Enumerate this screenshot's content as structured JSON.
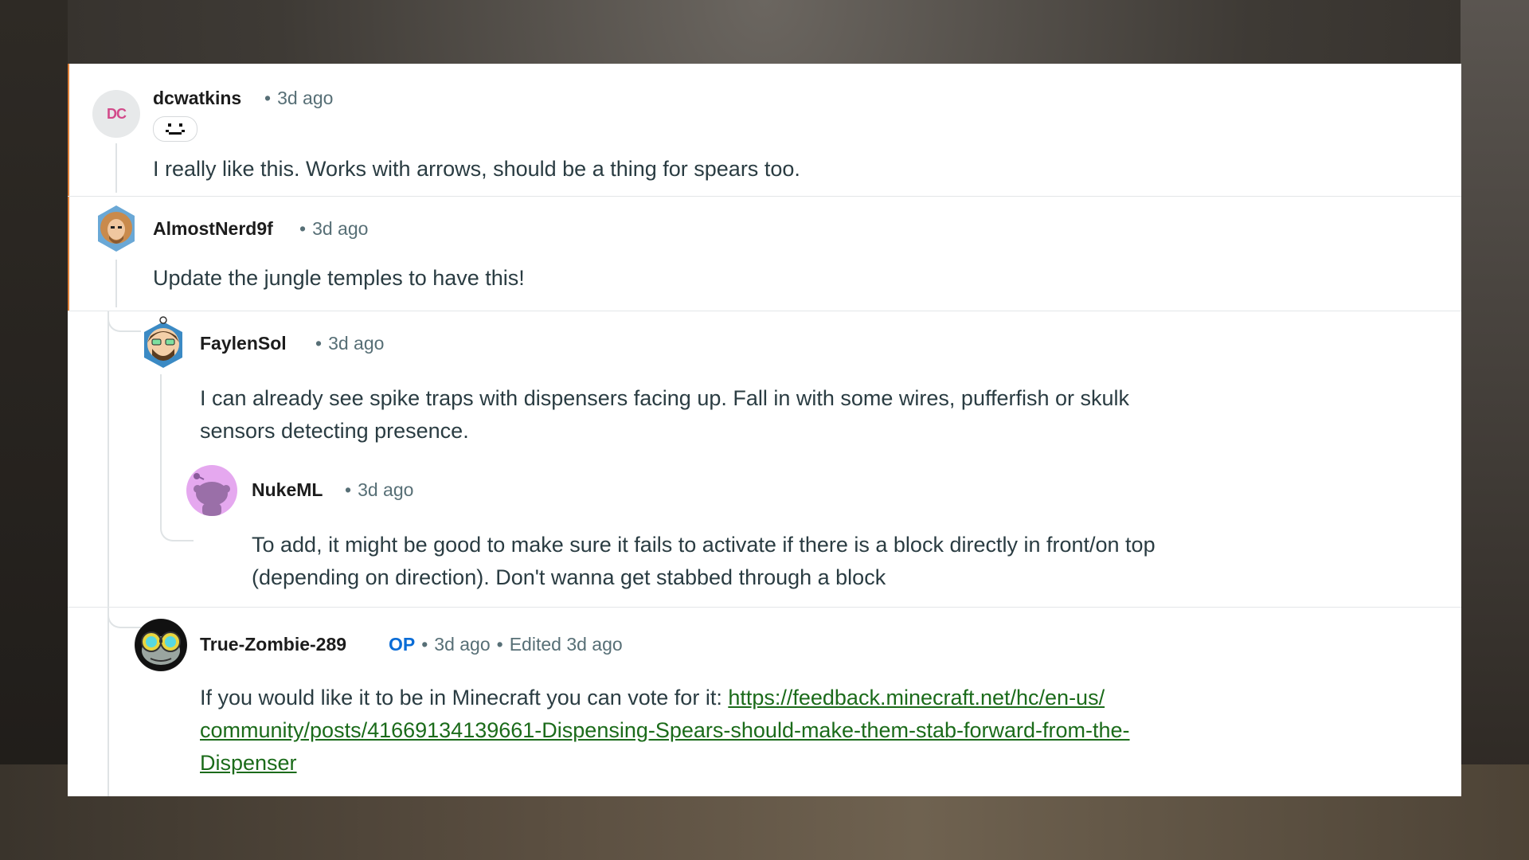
{
  "comments": [
    {
      "username": "dcwatkins",
      "time": "3d ago",
      "avatar_text": "DC",
      "flair_icon": "face-flair-icon",
      "body": "I really like this. Works with arrows, should be a thing for spears too."
    },
    {
      "username": "AlmostNerd9f",
      "time": "3d ago",
      "body": "Update the jungle temples to have this!"
    },
    {
      "username": "FaylenSol",
      "time": "3d ago",
      "body_line1": "I can already see spike traps with dispensers facing up. Fall in with some wires, pufferfish or skulk",
      "body_line2": "sensors detecting presence."
    },
    {
      "username": "NukeML",
      "time": "3d ago",
      "body_line1": "To add, it might be good to make sure it fails to activate if there is a block directly in front/on top",
      "body_line2": "(depending on direction). Don't wanna get stabbed through a block"
    },
    {
      "username": "True-Zombie-289",
      "op_badge": "OP",
      "time": "3d ago",
      "edited": "Edited 3d ago",
      "body_prefix": "If you would like it to be in Minecraft you can vote for it: ",
      "link_line1": "https://feedback.minecraft.net/hc/en-us/",
      "link_line2": "community/posts/41669134139661-Dispensing-Spears-should-make-them-stab-forward-from-the-",
      "link_line3": "Dispenser"
    }
  ],
  "colors": {
    "highlight": "#e0813a",
    "op": "#0a6cd6",
    "link": "#1b6b1a"
  }
}
